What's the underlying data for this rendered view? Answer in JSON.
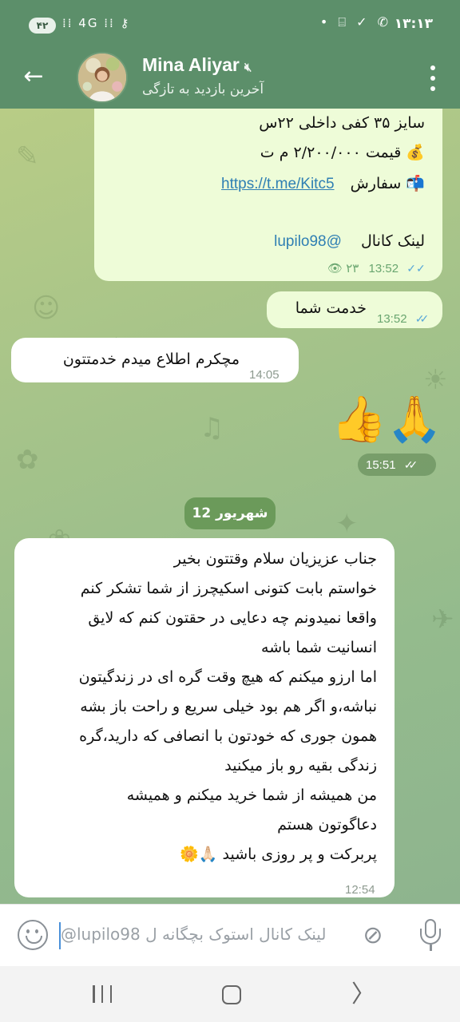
{
  "status_bar": {
    "time": "۱۳:۱۳",
    "battery": "۴۲",
    "left_icons": "⁞⁞ 4G ⁞⁞ ⚷",
    "right_icons": "• ⌸ ✓ ✆"
  },
  "header": {
    "contact_name": "Mina Aliyar",
    "last_seen": "آخرین بازدید به تازگی"
  },
  "messages": {
    "m1": {
      "size_line": "سایز ۳۵ کفی داخلی ۲۲س",
      "price_line": "قیمت ۲/۲۰۰/۰۰۰ م ت",
      "price_emoji": "💰",
      "order_label": "سفارش",
      "order_emoji": "📬",
      "order_link": "https://t.me/Kitc5",
      "channel_label": "لینک کانال",
      "channel_handle": "@lupilo98",
      "views": "۲۳",
      "time": "13:52"
    },
    "m2": {
      "text": "خدمت شما",
      "time": "13:52"
    },
    "m3": {
      "text": "مچکرم اطلاع میدم خدمتتون",
      "time": "14:05"
    },
    "m4": {
      "emojis": "👍🙏",
      "time": "15:51"
    },
    "date_separator": "12 شهریور",
    "m5": {
      "lines": [
        "جناب عزیزیان سلام وقتتون بخیر",
        "خواستم بابت کتونی اسکیچرز از شما تشکر کنم",
        "واقعا نمیدونم چه دعایی در حقتون کنم که لایق",
        "انسانیت شما باشه",
        "اما ارزو میکنم که هیچ وقت گره ای در زندگیتون",
        "نباشه،و اگر هم بود خیلی سریع و راحت باز بشه",
        "همون جوری که خودتون با انصافی که دارید،گره",
        "زندگی بقیه رو باز میکنید",
        "من همیشه از شما خرید میکنم و همیشه",
        "دعاگوتون هستم",
        "پربرکت و پر روزی باشید 🙏🏻🌼"
      ],
      "time": "12:54"
    }
  },
  "input": {
    "value": "@lupilo98 لینک کانال استوک بچگانه ل"
  },
  "colors": {
    "header": "#5c8f6a",
    "outgoing_bubble": "#eefcd8",
    "incoming_bubble": "#ffffff",
    "link": "#2f7fb3",
    "date_pill": "#6b9a5a"
  },
  "icons": [
    "back-arrow-icon",
    "mute-icon",
    "more-vert-icon",
    "eye-icon",
    "double-check-icon",
    "emoji-icon",
    "attach-icon",
    "mic-icon",
    "nav-recents-icon",
    "nav-home-icon",
    "nav-back-icon"
  ]
}
